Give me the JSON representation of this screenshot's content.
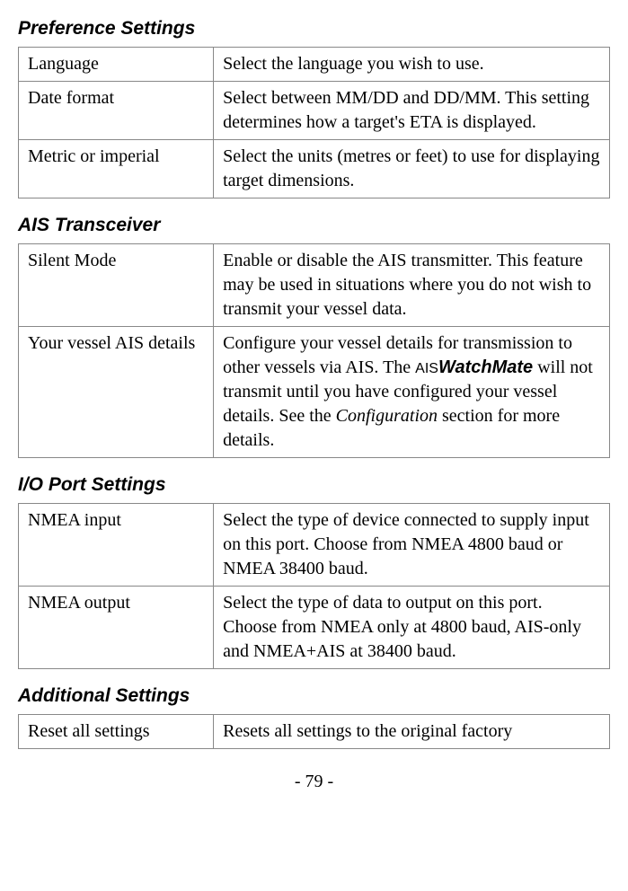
{
  "sections": {
    "preference": {
      "heading": "Preference Settings",
      "rows": {
        "language": {
          "label": "Language",
          "desc": "Select the language you wish to use."
        },
        "date_format": {
          "label": "Date format",
          "desc": "Select between MM/DD and DD/MM. This setting determines how a target's ETA is displayed."
        },
        "metric_imperial": {
          "label": "Metric or imperial",
          "desc": "Select the units (metres or feet) to use for displaying target dimensions."
        }
      }
    },
    "ais": {
      "heading": "AIS Transceiver",
      "rows": {
        "silent_mode": {
          "label": "Silent Mode",
          "desc": "Enable or disable the AIS transmitter. This feature may be used in situations where you do not wish to transmit your vessel data."
        },
        "vessel_details": {
          "label": "Your vessel AIS details",
          "desc_pre": "Configure your vessel details for transmission to other vessels via AIS. The ",
          "brand_prefix": "AIS",
          "brand": "WatchMate",
          "desc_mid": " will not transmit until you have configured your vessel details. See the ",
          "config": "Configuration",
          "desc_post": " section for more details."
        }
      }
    },
    "io": {
      "heading": "I/O Port Settings",
      "rows": {
        "nmea_input": {
          "label": "NMEA input",
          "desc": "Select the type of device connected to supply input on this port. Choose from NMEA 4800 baud or NMEA 38400 baud."
        },
        "nmea_output": {
          "label": "NMEA output",
          "desc": "Select the type of data to output on this port. Choose from NMEA only at 4800 baud, AIS-only and NMEA+AIS at 38400 baud."
        }
      }
    },
    "additional": {
      "heading": "Additional Settings",
      "rows": {
        "reset": {
          "label": "Reset all settings",
          "desc": "Resets all settings to the original factory"
        }
      }
    }
  },
  "page_number": "- 79 -"
}
